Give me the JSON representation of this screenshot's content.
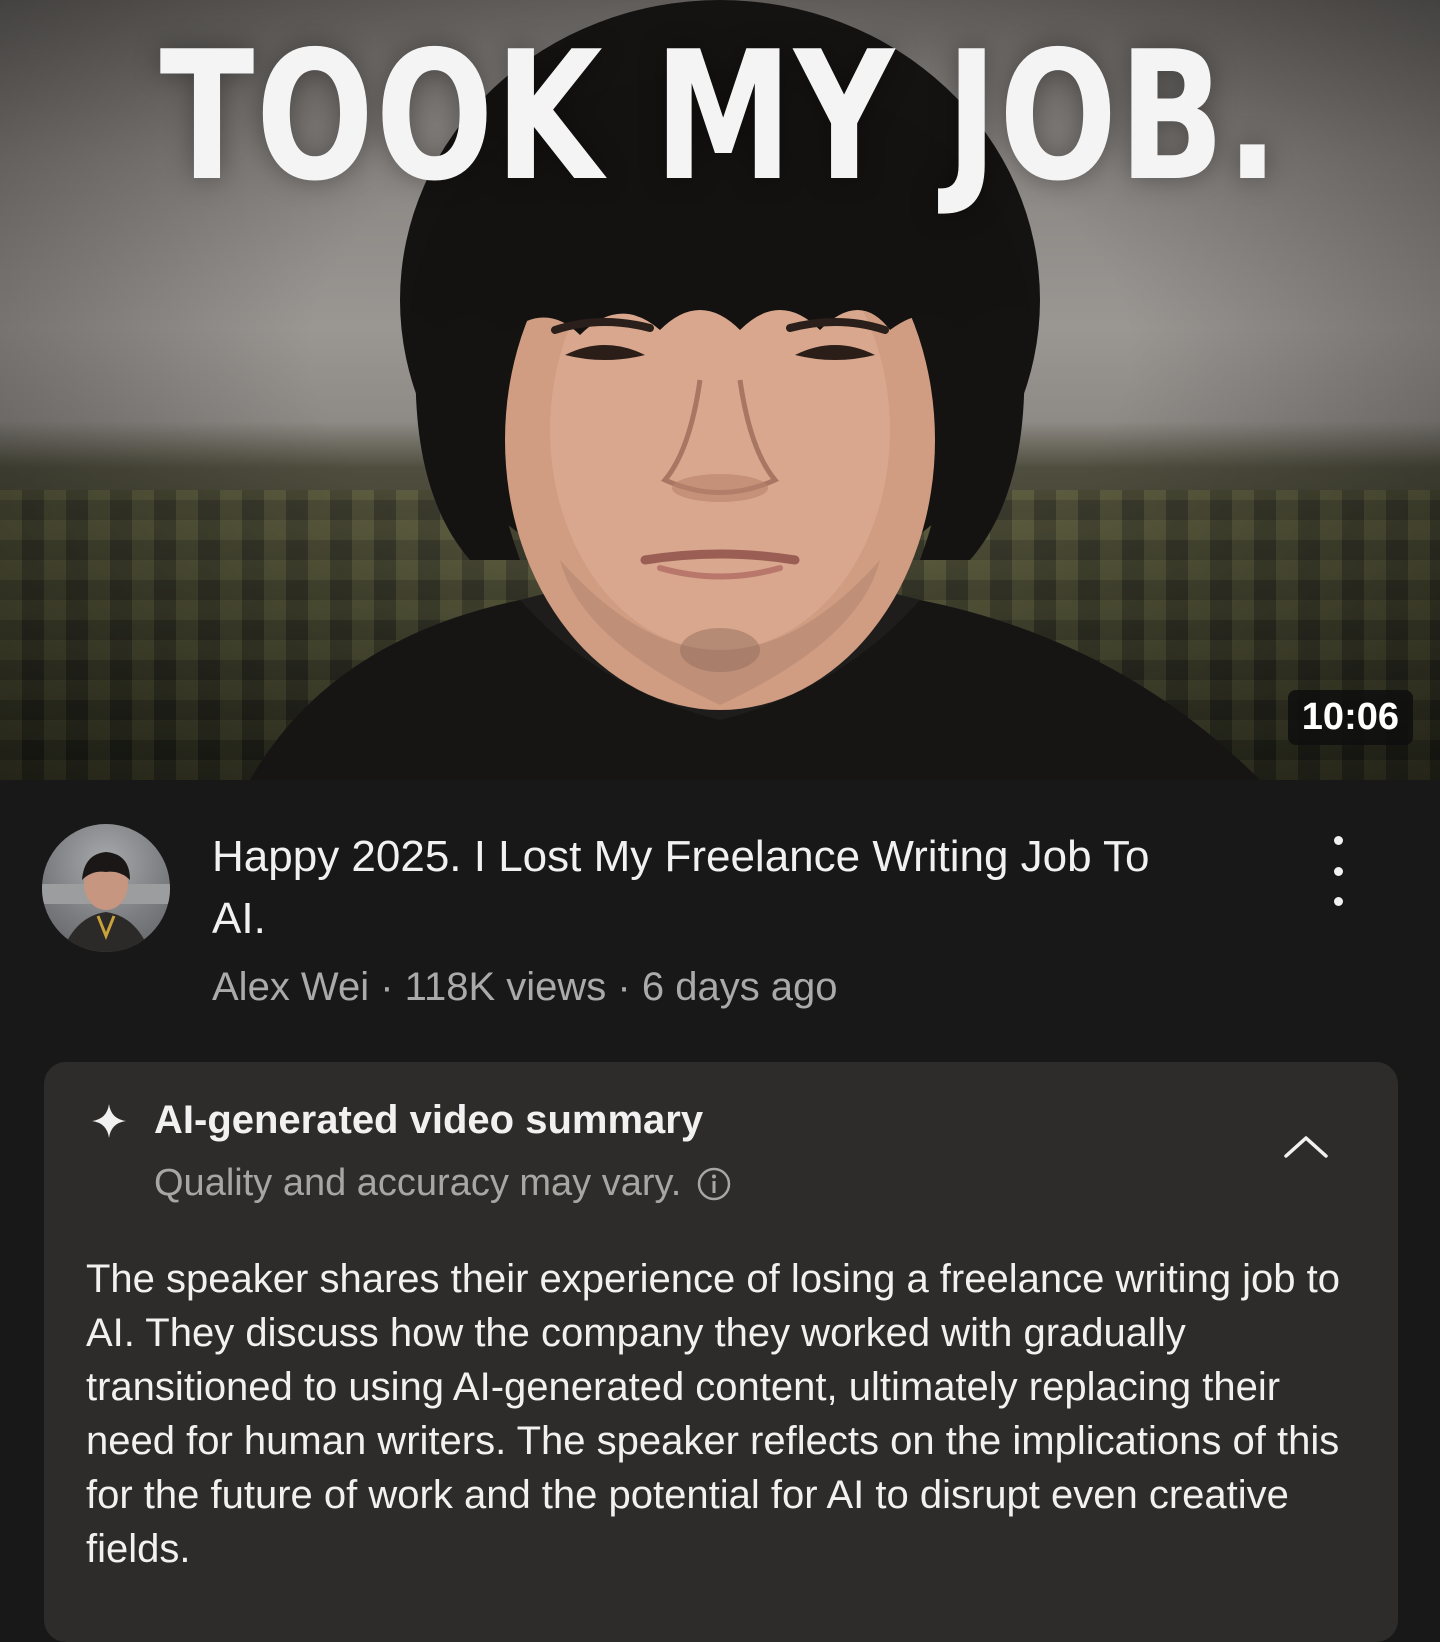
{
  "thumbnail": {
    "overlay_text": "TOOK MY JOB.",
    "duration": "10:06"
  },
  "video": {
    "title": "Happy 2025. I Lost My Freelance Writing Job To AI.",
    "channel": "Alex Wei",
    "separator": "·",
    "views": "118K views",
    "age": "6 days ago"
  },
  "summary": {
    "heading": "AI-generated video summary",
    "disclaimer": "Quality and accuracy may vary.",
    "body": "The speaker shares their experience of losing a freelance writing job to AI. They discuss how the company they worked with gradually transitioned to using AI-generated content, ultimately replacing their need for human writers. The speaker reflects on the implications of this for the future of work and the potential for AI to disrupt even creative fields."
  },
  "icons": {
    "more": "more-vertical-icon",
    "sparkle": "sparkle-icon",
    "info": "info-icon",
    "collapse": "chevron-up-icon"
  },
  "colors": {
    "background": "#181818",
    "card": "#2e2c2a",
    "primary_text": "#f1f1f1",
    "secondary_text": "#aaaaaa"
  }
}
